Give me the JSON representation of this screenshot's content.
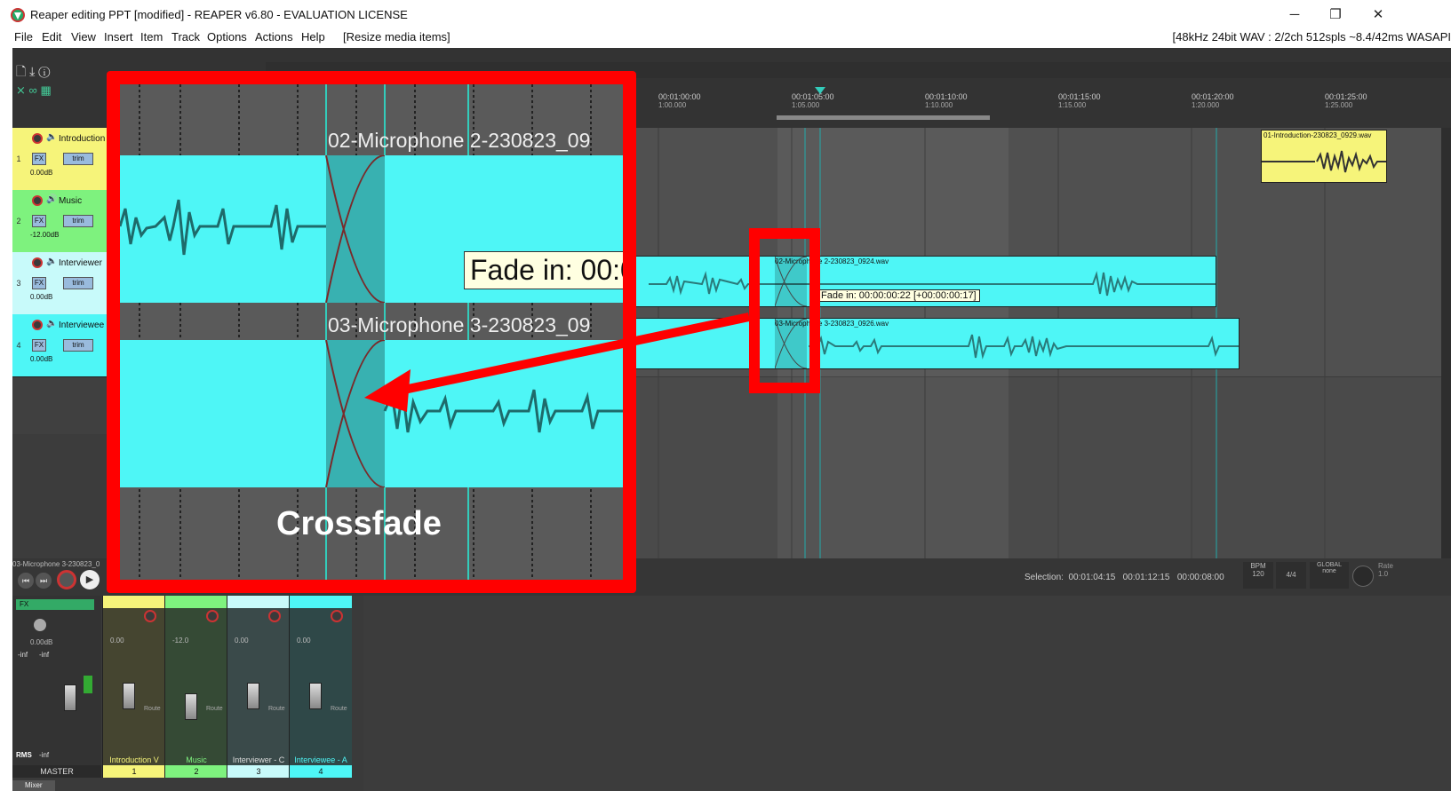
{
  "window": {
    "title": "Reaper editing PPT [modified] - REAPER v6.80 - EVALUATION LICENSE",
    "minimize": "─",
    "restore": "❐",
    "close": "✕"
  },
  "menu": {
    "items": [
      "File",
      "Edit",
      "View",
      "Insert",
      "Item",
      "Track",
      "Options",
      "Actions",
      "Help"
    ],
    "action_hint": "[Resize media items]",
    "audio_info": "[48kHz 24bit WAV : 2/2ch 512spls ~8.4/42ms WASAPI"
  },
  "ruler": {
    "ticks": [
      {
        "label": "00:01:00:00",
        "sub": "1:00.000"
      },
      {
        "label": "00:01:05:00",
        "sub": "1:05.000"
      },
      {
        "label": "00:01:10:00",
        "sub": "1:10.000"
      },
      {
        "label": "00:01:15:00",
        "sub": "1:15.000"
      },
      {
        "label": "00:01:20:00",
        "sub": "1:20.000"
      },
      {
        "label": "00:01:25:00",
        "sub": "1:25.000"
      }
    ]
  },
  "tracks": [
    {
      "num": "1",
      "name": "Introduction",
      "volume": "0.00dB",
      "color": "#f6f47a"
    },
    {
      "num": "2",
      "name": "Music",
      "volume": "-12.00dB",
      "color": "#7ef27e"
    },
    {
      "num": "3",
      "name": "Interviewer",
      "volume": "0.00dB",
      "color": "#c8fafa"
    },
    {
      "num": "4",
      "name": "Interviewee",
      "volume": "0.00dB",
      "color": "#4ef6f6"
    }
  ],
  "track_buttons": {
    "fx": "FX",
    "trim": "trim"
  },
  "items": {
    "intro": "01-Introduction-230823_0929.wav",
    "mic2": "02-Microphone 2-230823_0924.wav",
    "mic3": "03-Microphone 3-230823_0926.wav"
  },
  "tooltip_small": "Fade in: 00:00:00:22 [+00:00:00:17]",
  "zoom": {
    "mic2_title": "02-Microphone 2-230823_09",
    "mic3_title": "03-Microphone 3-230823_09",
    "tooltip": "Fade in: 00:0",
    "label": "Crossfade"
  },
  "transport": {
    "selected_item": "03-Microphone 3-230823_0",
    "selection_label": "Selection:",
    "selection_start": "00:01:04:15",
    "selection_end": "00:01:12:15",
    "selection_length": "00:00:08:00",
    "bpm_label": "BPM",
    "bpm": "120",
    "time_sig": "4/4",
    "global_label": "GLOBAL",
    "global_value": "none",
    "rate_label": "Rate",
    "rate_value": "1.0"
  },
  "mixer": {
    "tab": "Mixer",
    "master_label": "MASTER",
    "master_volume": "0.00dB",
    "master_peaks": [
      "-inf",
      "-inf"
    ],
    "rms_label": "RMS",
    "rms_value": "-inf",
    "fx_label": "FX",
    "route": "Route",
    "strips": [
      {
        "name": "Introduction V",
        "num": "1",
        "volume": "0.00",
        "color": "#f6f47a"
      },
      {
        "name": "Music",
        "num": "2",
        "volume": "-12.0",
        "color": "#7ef27e"
      },
      {
        "name": "Interviewer - C",
        "num": "3",
        "volume": "0.00",
        "color": "#c8fafa"
      },
      {
        "name": "Interviewee - A",
        "num": "4",
        "volume": "0.00",
        "color": "#4ef6f6"
      }
    ]
  },
  "colors": {
    "callout_red": "#ff0000",
    "item_cyan": "#4ef6f6",
    "intro_yellow": "#f6f47a"
  }
}
